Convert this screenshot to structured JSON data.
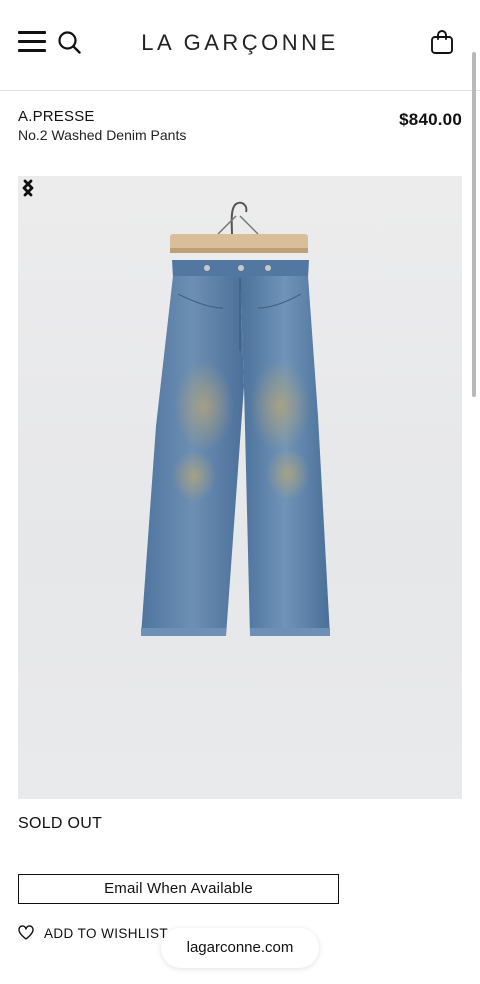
{
  "header": {
    "logo_text": "LA GARÇONNE",
    "menu_icon": "hamburger-menu-icon",
    "search_icon": "search-icon",
    "bag_icon": "shopping-bag-icon"
  },
  "product": {
    "brand": "A.PRESSE",
    "name": "No.2 Washed Denim Pants",
    "price": "$840.00",
    "image_alt": "denim-pants-on-hanger",
    "status": "SOLD OUT"
  },
  "gallery": {
    "prev_icon": "chevron-left-icon",
    "next_icon": "chevron-right-icon"
  },
  "actions": {
    "email_label": "Email When Available",
    "wishlist_label": "ADD TO WISHLIST",
    "wishlist_icon": "heart-icon"
  },
  "browser": {
    "url": "lagarconne.com"
  },
  "colors": {
    "text": "#111111",
    "denim": "#5d82aa",
    "image_background": "#e9e9eb"
  }
}
